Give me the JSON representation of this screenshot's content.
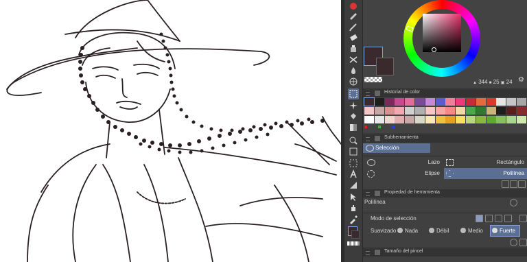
{
  "color_wheel": {
    "values": [
      "344",
      "25",
      "24"
    ]
  },
  "color_history": {
    "title": "Historial de color",
    "rows": [
      [
        "#3a2a2e",
        "#1e1e1e",
        "#7b2a5b",
        "#c54a8e",
        "#e46c9c",
        "#7a4a9a",
        "#c48ad8",
        "#5e5ad0",
        "#f27f9a",
        "#ee3a7a",
        "#c72a3a",
        "#e66a3a",
        "#d93a2a",
        "#e6e6e6",
        "#c6c6c6",
        "#a7a7a7"
      ],
      [
        "#f4c7c7",
        "#c6a6a6",
        "#d99090",
        "#f2aab2",
        "#d0d0d0",
        "#b0b0b0",
        "#fbc6c6",
        "#fba6a6",
        "#fb8686",
        "#f2d7a8",
        "#4aa84a",
        "#2f7a2f",
        "#c9b57a",
        "#1e1e1e",
        "#5a1e1e",
        "#8a2a2a"
      ],
      [
        "#ffffff",
        "#e8e8e8",
        "#f0d8d0",
        "#e0b0b0",
        "#c8a8a8",
        "#d8d8c8",
        "#f8e8b8",
        "#f0c040",
        "#e8a020",
        "#f8e060",
        "#b8d880",
        "#88b840",
        "#60a830",
        "#88c060",
        "#a8d890",
        "#d0e8b0"
      ]
    ],
    "markers": [
      "red",
      "green",
      "blue"
    ]
  },
  "subtool": {
    "title": "Subherramienta",
    "selected": "Selección",
    "items": [
      {
        "label": "Lazo",
        "icon": "lasso-icon"
      },
      {
        "label": "Rectángulo",
        "icon": "rectangle-icon"
      },
      {
        "label": "Elipse",
        "icon": "ellipse-icon"
      },
      {
        "label": "Polilínea",
        "icon": "polyline-icon"
      }
    ]
  },
  "tool_property": {
    "title": "Propiedad de herramienta",
    "tool_name": "Polilínea",
    "selection_mode_label": "Modo de selección",
    "smoothing_label": "Suavizado",
    "smoothing_options": [
      "Nada",
      "Débil",
      "Medio",
      "Fuerte"
    ],
    "smoothing_selected": "Fuerte"
  },
  "brush_size": {
    "title": "Tamaño del pincel"
  },
  "colors": {
    "accent": "#5b6f93",
    "main_color": "#3a2a2e",
    "sub_color": "#3a2a2e"
  }
}
